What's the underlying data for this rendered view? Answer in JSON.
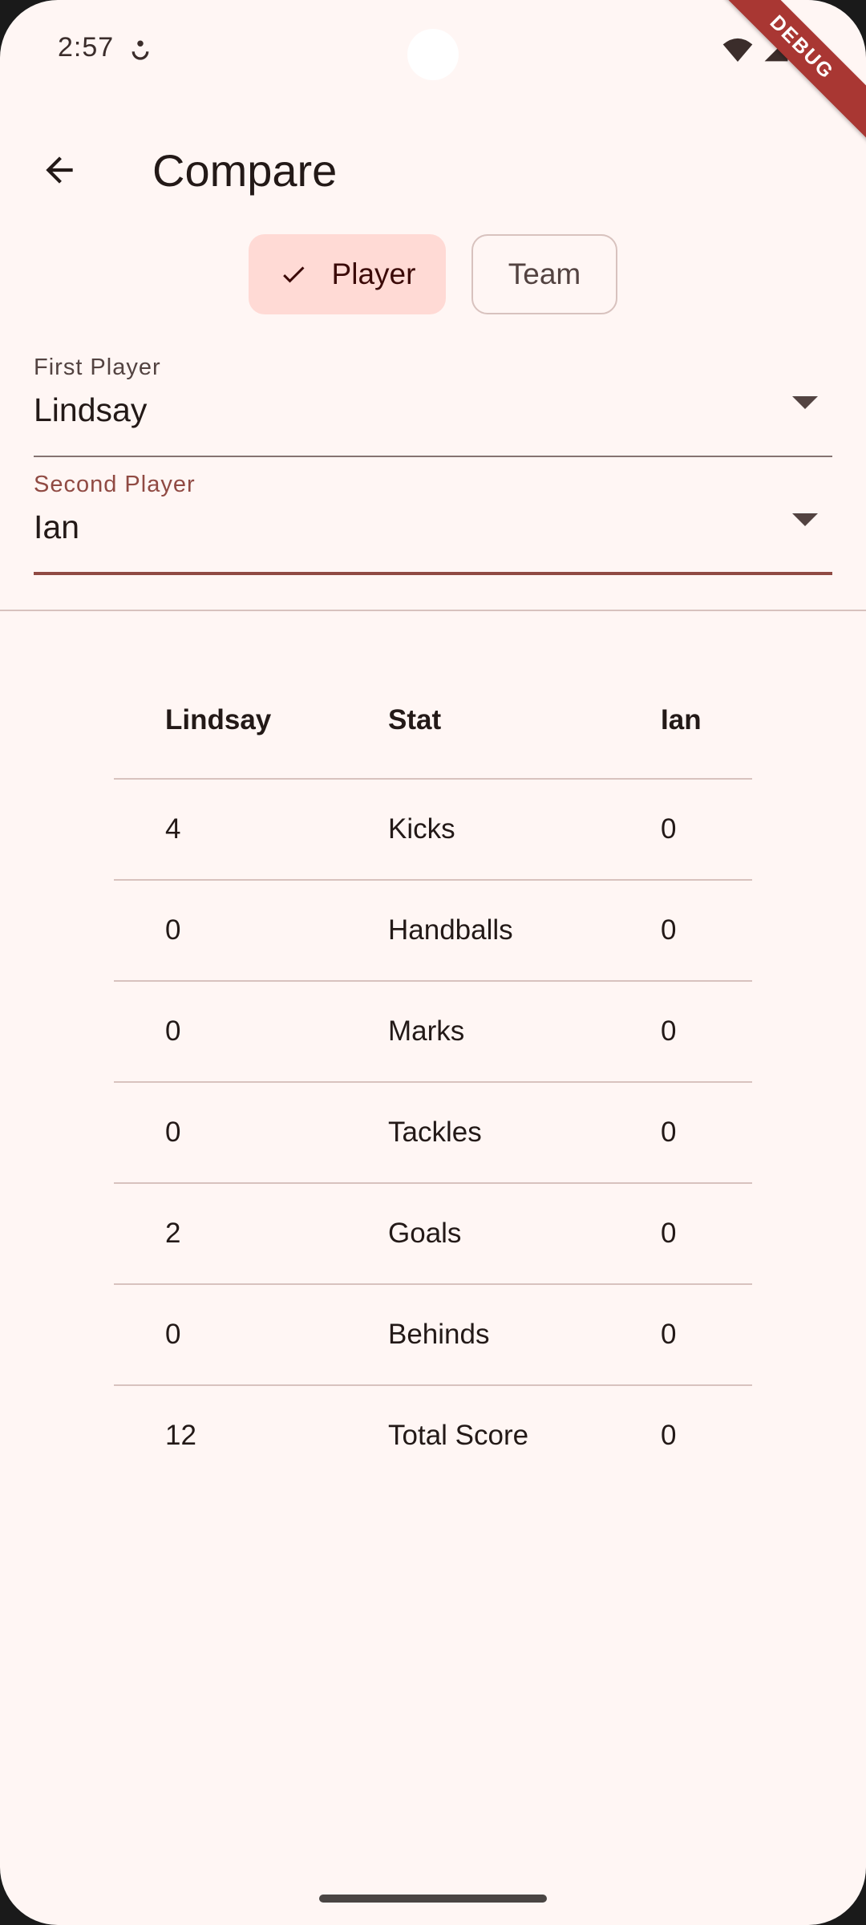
{
  "status_bar": {
    "time": "2:57",
    "debug_label": "DEBUG"
  },
  "app_bar": {
    "title": "Compare",
    "back_icon": "arrow-back-icon"
  },
  "segments": {
    "player_label": "Player",
    "team_label": "Team",
    "selected": "Player"
  },
  "first_player": {
    "label": "First Player",
    "value": "Lindsay"
  },
  "second_player": {
    "label": "Second Player",
    "value": "Ian"
  },
  "table": {
    "headers": [
      "Lindsay",
      "Stat",
      "Ian"
    ],
    "rows": [
      [
        "4",
        "Kicks",
        "0"
      ],
      [
        "0",
        "Handballs",
        "0"
      ],
      [
        "0",
        "Marks",
        "0"
      ],
      [
        "0",
        "Tackles",
        "0"
      ],
      [
        "2",
        "Goals",
        "0"
      ],
      [
        "0",
        "Behinds",
        "0"
      ],
      [
        "12",
        "Total Score",
        "0"
      ]
    ]
  },
  "colors": {
    "background": "#fff6f4",
    "selected_chip": "#ffdad5",
    "accent": "#904a43",
    "divider": "#d8c2be",
    "debug_ribbon": "#a93733"
  }
}
